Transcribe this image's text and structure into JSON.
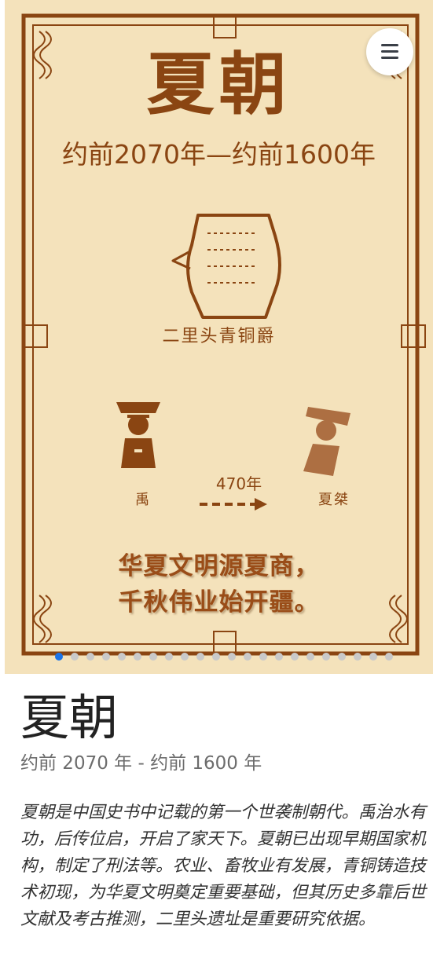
{
  "poster": {
    "title": "夏朝",
    "dates": "约前2070年—约前1600年",
    "artifact_caption": "二里头青铜爵",
    "figure_left_label": "禹",
    "figure_right_label": "夏桀",
    "span_label": "470年",
    "poem_line1": "华夏文明源夏商，",
    "poem_line2": "千秋伟业始开疆。",
    "colors": {
      "background": "#f4e2bb",
      "ink": "#8a4512",
      "figure_light": "#ad6f42"
    }
  },
  "menu": {
    "icon": "hamburger-menu-icon"
  },
  "carousel": {
    "total": 22,
    "active_index": 0,
    "active_color": "#1a73e8",
    "inactive_color": "#c9c9c9"
  },
  "content": {
    "heading": "夏朝",
    "subheading": "约前 2070 年 - 约前 1600 年",
    "description": "夏朝是中国史书中记载的第一个世袭制朝代。禹治水有功，后传位启，开启了家天下。夏朝已出现早期国家机构，制定了刑法等。农业、畜牧业有发展，青铜铸造技术初现，为华夏文明奠定重要基础，但其历史多靠后世文献及考古推测，二里头遗址是重要研究依据。"
  }
}
